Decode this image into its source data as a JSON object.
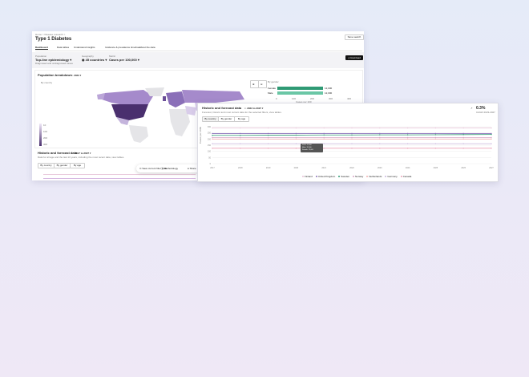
{
  "header": {
    "breadcrumb": [
      "Home",
      "Disease research"
    ],
    "title": "Type 1 Diabetes",
    "save_label": "Save search"
  },
  "tabs": [
    {
      "label": "Dashboard",
      "active": true
    },
    {
      "label": "Data tables",
      "active": false
    },
    {
      "label": "Understand insights",
      "active": false
    },
    {
      "label": "Incidence & prevalence timelines",
      "active": false
    },
    {
      "label": "About the data",
      "active": false
    }
  ],
  "filters": {
    "population": {
      "label": "Population",
      "value": "Top-line epidemiology",
      "note": "Diagnosed and undiagnosed cases"
    },
    "geography": {
      "label": "Geography",
      "value": "45 countries"
    },
    "metric": {
      "label": "Metric",
      "value": "Cases per 100,000"
    },
    "download_label": "Download"
  },
  "breakdown": {
    "title": "Population breakdown",
    "year": "2023",
    "map_sub": "By country",
    "legend_ticks": [
      "10",
      "100",
      "200",
      "300"
    ],
    "gender": {
      "title": "By gender",
      "bars": [
        {
          "label": "Female",
          "value": "12,000",
          "fraction": 0.95
        },
        {
          "label": "Male",
          "value": "12,000",
          "fraction": 0.95
        }
      ],
      "axis": [
        "0",
        "100",
        "200",
        "300",
        "400"
      ],
      "axis_label": "Cases per 100"
    }
  },
  "historic": {
    "title": "Historic and forecast data",
    "range": "2017 to 2027",
    "desc": "Data for all age and the last 10 years, including the most recent data, view tables.",
    "tabs": [
      "By country",
      "By gender",
      "By age"
    ]
  },
  "toolbar": {
    "items": [
      "Save current filter state",
      "Methodology",
      "Share"
    ]
  },
  "overlay": {
    "title": "Historic and forecast data",
    "range": "2023 to 2027",
    "desc": "Forecast, historic and most current data for the selected filters, view tables.",
    "tabs": [
      "By country",
      "By gender",
      "By age"
    ],
    "stat": {
      "value": "0.3%",
      "label": "CAGR 2023-2027"
    },
    "y_label": "Cases per 100k",
    "y_ticks": [
      "300",
      "250",
      "200",
      "150",
      "100",
      "50",
      "0"
    ],
    "tooltip": [
      "2023: 12,000",
      "Male: 12,000",
      "Female: 12,000"
    ],
    "legend": [
      "Finland",
      "United Kingdom",
      "Sweden",
      "Norway",
      "Netherlands",
      "Germany",
      "Canada"
    ]
  },
  "chart_data": {
    "type": "line",
    "x": [
      "2017",
      "2018",
      "2019",
      "2020",
      "2021",
      "2022",
      "2023",
      "2024",
      "2025",
      "2026",
      "2027"
    ],
    "ylim": [
      0,
      300
    ],
    "series": [
      {
        "name": "Finland",
        "color": "#e6c2d6",
        "values": [
          290,
          290,
          290,
          290,
          290,
          290,
          290,
          290,
          290,
          290,
          290
        ]
      },
      {
        "name": "United Kingdom",
        "color": "#8a6fb8",
        "values": [
          245,
          245,
          245,
          245,
          245,
          245,
          245,
          245,
          245,
          245,
          245
        ]
      },
      {
        "name": "Sweden",
        "color": "#2f9a74",
        "values": [
          230,
          230,
          231,
          232,
          233,
          233,
          234,
          234,
          235,
          236,
          237
        ]
      },
      {
        "name": "Norway",
        "color": "#d7a6c6",
        "values": [
          212,
          212,
          212,
          212,
          212,
          212,
          212,
          212,
          212,
          212,
          212
        ]
      },
      {
        "name": "Netherlands",
        "color": "#f0b2b2",
        "values": [
          200,
          200,
          200,
          200,
          200,
          200,
          200,
          200,
          200,
          200,
          200
        ]
      },
      {
        "name": "Germany",
        "color": "#c9b5de",
        "values": [
          162,
          162,
          162,
          162,
          162,
          162,
          162,
          162,
          162,
          162,
          162
        ]
      },
      {
        "name": "Canada",
        "color": "#e9a1b8",
        "values": [
          125,
          125,
          125,
          125,
          125,
          125,
          125,
          125,
          125,
          125,
          125
        ]
      }
    ]
  }
}
